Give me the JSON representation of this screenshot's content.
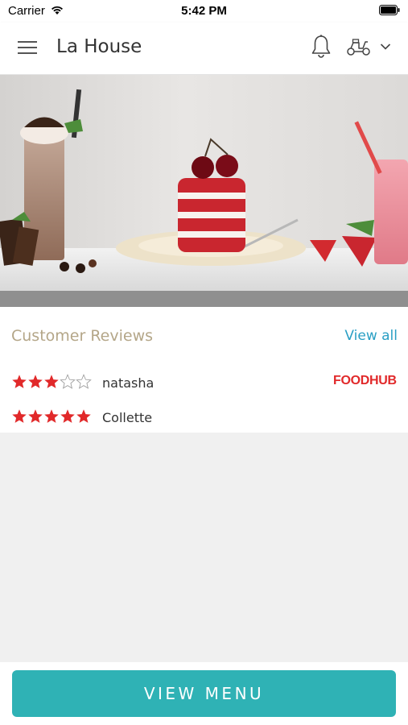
{
  "status_bar": {
    "carrier": "Carrier",
    "time": "5:42 PM",
    "wifi_icon": "wifi-icon",
    "battery_icon": "battery-icon"
  },
  "header": {
    "title": "La House",
    "menu_icon": "hamburger-menu-icon",
    "bell_icon": "bell-icon",
    "delivery_icon": "scooter-icon",
    "dropdown_icon": "chevron-down-icon"
  },
  "hero": {
    "image": "desserts-banner"
  },
  "reviews": {
    "title": "Customer Reviews",
    "view_all": "View all",
    "star_color": "#e1292a",
    "items": [
      {
        "name": "natasha",
        "rating": 3,
        "max": 5,
        "source": "FOODHUB"
      },
      {
        "name": "Collette",
        "rating": 5,
        "max": 5
      }
    ]
  },
  "footer": {
    "button_label": "VIEW MENU",
    "button_color": "#2fb2b5"
  }
}
